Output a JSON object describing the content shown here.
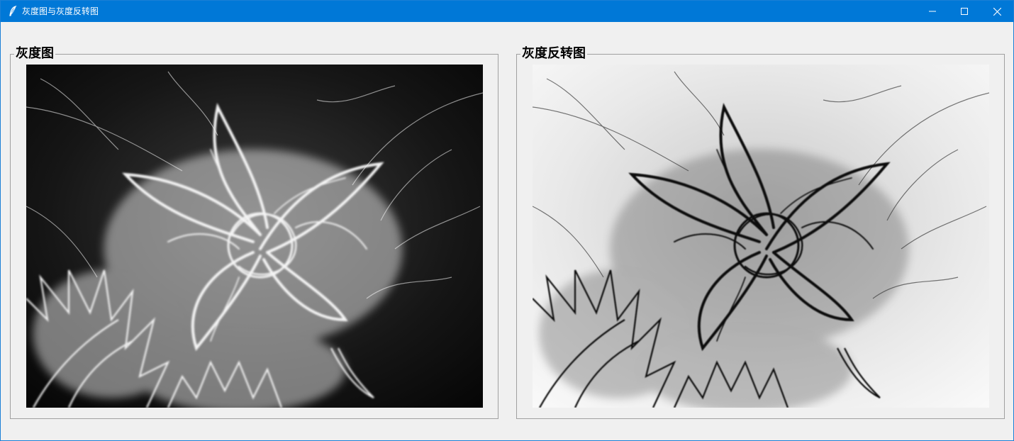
{
  "window": {
    "title": "灰度图与灰度反转图",
    "controls": [
      "minimize-icon",
      "maximize-icon",
      "close-icon"
    ]
  },
  "panels": {
    "gray": {
      "label": "灰度图"
    },
    "inverted": {
      "label": "灰度反转图"
    }
  }
}
